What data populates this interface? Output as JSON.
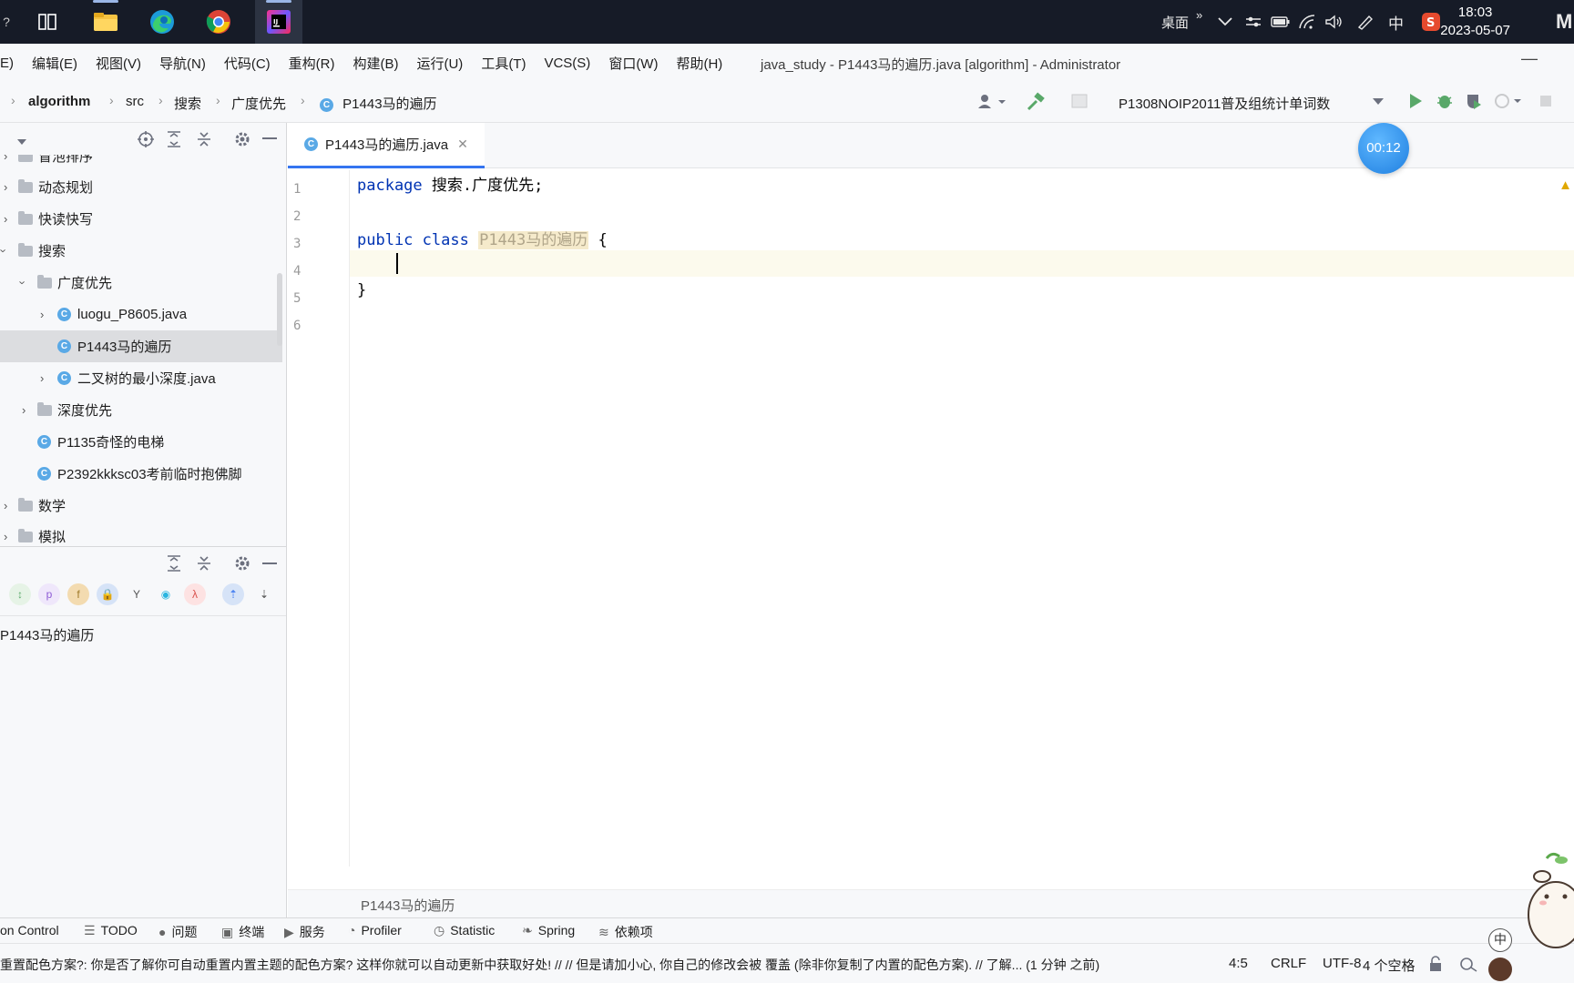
{
  "taskbar": {
    "tray_label": "桌面",
    "tray_more": "»",
    "ime": "中",
    "time": "18:03",
    "date": "2023-05-07",
    "apps": [
      "task-view",
      "file-explorer",
      "edge",
      "chrome",
      "intellij-idea"
    ]
  },
  "menubar": {
    "items": [
      {
        "label": "E)",
        "id": "edit-partial"
      },
      {
        "label": "编辑(E)"
      },
      {
        "label": "视图(V)"
      },
      {
        "label": "导航(N)"
      },
      {
        "label": "代码(C)"
      },
      {
        "label": "重构(R)"
      },
      {
        "label": "构建(B)"
      },
      {
        "label": "运行(U)"
      },
      {
        "label": "工具(T)"
      },
      {
        "label": "VCS(S)"
      },
      {
        "label": "窗口(W)"
      },
      {
        "label": "帮助(H)"
      }
    ],
    "window_title": "java_study - P1443马的遍历.java [algorithm] - Administrator",
    "minimize": "—"
  },
  "navbar": {
    "breadcrumbs": [
      "algorithm",
      "src",
      "搜索",
      "广度优先",
      "P1443马的遍历"
    ],
    "run_config": "P1308NOIP2011普及组统计单词数"
  },
  "project_tree": {
    "rows": [
      {
        "label": "冒泡排序",
        "type": "folder",
        "expanded": false,
        "level": 0
      },
      {
        "label": "动态规划",
        "type": "folder",
        "expanded": false,
        "level": 0
      },
      {
        "label": "快读快写",
        "type": "folder",
        "expanded": false,
        "level": 0
      },
      {
        "label": "搜索",
        "type": "folder",
        "expanded": true,
        "level": 0
      },
      {
        "label": "广度优先",
        "type": "folder",
        "expanded": true,
        "level": 1
      },
      {
        "label": "luogu_P8605.java",
        "type": "class",
        "expanded": false,
        "level": 2
      },
      {
        "label": "P1443马的遍历",
        "type": "class",
        "selected": true,
        "level": 2
      },
      {
        "label": "二叉树的最小深度.java",
        "type": "class",
        "expanded": false,
        "level": 2
      },
      {
        "label": "深度优先",
        "type": "folder",
        "expanded": false,
        "level": 1
      },
      {
        "label": "P1135奇怪的电梯",
        "type": "class",
        "level": 1
      },
      {
        "label": "P2392kkksc03考前临时抱佛脚",
        "type": "class",
        "level": 1
      },
      {
        "label": "数学",
        "type": "folder",
        "expanded": false,
        "level": 0
      },
      {
        "label": "模拟",
        "type": "folder",
        "expanded": false,
        "level": 0
      }
    ]
  },
  "structure": {
    "root": "P1443马的遍历"
  },
  "editor": {
    "tab_label": "P1443马的遍历.java",
    "tab_icon": "C",
    "timer": "00:12",
    "lines": [
      {
        "n": "1",
        "kw": "package",
        "rest": " 搜索.广度优先;"
      },
      {
        "n": "2",
        "kw": "",
        "rest": ""
      },
      {
        "n": "3",
        "kw": "public class",
        "name": "P1443马的遍历",
        "rest": " {"
      },
      {
        "n": "4",
        "kw": "",
        "rest": ""
      },
      {
        "n": "5",
        "kw": "",
        "rest": "}"
      },
      {
        "n": "6",
        "kw": "",
        "rest": ""
      }
    ],
    "bottom_breadcrumb": "P1443马的遍历"
  },
  "toolstrip": {
    "items": [
      {
        "label": "on Control",
        "icon": ""
      },
      {
        "label": "TODO",
        "icon": "☰"
      },
      {
        "label": "问题",
        "icon": "●"
      },
      {
        "label": "终端",
        "icon": "▣"
      },
      {
        "label": "服务",
        "icon": "▶"
      },
      {
        "label": "Profiler",
        "icon": "◔"
      },
      {
        "label": "Statistic",
        "icon": "◷"
      },
      {
        "label": "Spring",
        "icon": "❧"
      },
      {
        "label": "依赖项",
        "icon": "≋"
      }
    ]
  },
  "statusbar": {
    "message": "重置配色方案?: 你是否了解你可自动重置内置主题的配色方案? 这样你就可以自动更新中获取好处! // // 但是请加小心, 你自己的修改会被 覆盖 (除非你复制了内置的配色方案). // 了解... (1 分钟 之前)",
    "position": "4:5",
    "line_sep": "CRLF",
    "encoding": "UTF-8",
    "indent": "4 个空格"
  },
  "colors": {
    "keyword": "#0033b3",
    "accent": "#3574f0",
    "taskbar": "#161b27"
  }
}
